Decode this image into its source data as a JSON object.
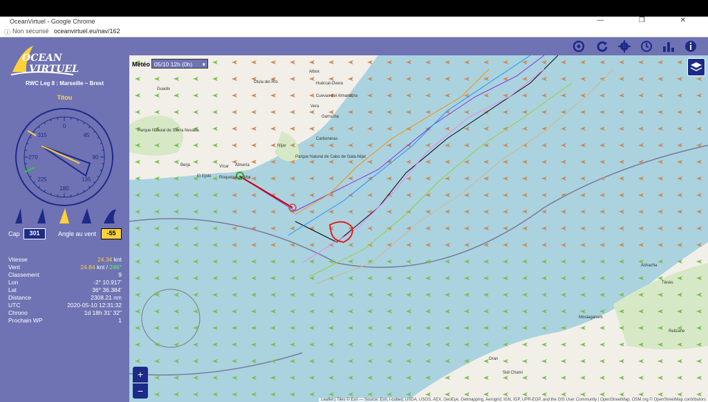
{
  "browser": {
    "window_title": "OceanVirtuel - Google Chrome",
    "security_label": "Non sécurisé",
    "url": "oceanvirtuel.eu/nav/162",
    "window_controls": "— ❐ ✕"
  },
  "logo": {
    "line1": "OCEAN",
    "line2": "VIRTUEL"
  },
  "race": {
    "title": "RWC Leg 8 : Marseille ~ Brest"
  },
  "boat": {
    "name": "Titou"
  },
  "compass": {
    "labels": [
      "0",
      "45",
      "90",
      "135",
      "180",
      "225",
      "270",
      "315"
    ]
  },
  "heading": {
    "cap_label": "Cap",
    "cap_value": "301",
    "wind_angle_label": "Angle au vent",
    "wind_angle_value": "-55"
  },
  "stats": [
    {
      "label": "Vitesse",
      "value": "24.34",
      "unit": " knt"
    },
    {
      "label": "Vent",
      "value": "24.84",
      "unit": " knt / ",
      "extra": "246°"
    },
    {
      "label": "Classement",
      "value": "9",
      "unit": ""
    },
    {
      "label": "Lon",
      "value": "-2° 10.917'",
      "unit": ""
    },
    {
      "label": "Lat",
      "value": "36° 36.384'",
      "unit": ""
    },
    {
      "label": "Distance",
      "value": "2308.21 nm",
      "unit": ""
    },
    {
      "label": "UTC",
      "value": "2020-05-10 12:31:32",
      "unit": ""
    },
    {
      "label": "Chrono",
      "value": "1d 18h 31' 32\"",
      "unit": ""
    },
    {
      "label": "Prochain WP",
      "value": "1",
      "unit": ""
    }
  ],
  "meteo": {
    "label": "Météo",
    "selected": "05/10 12h (0h)"
  },
  "zoom": {
    "in": "+",
    "out": "−"
  },
  "map_labels": [
    "Almería",
    "Roquetas de Mar",
    "Níjar",
    "Berja",
    "Vícar",
    "El Ejido",
    "Albox",
    "Huércal-Overa",
    "Cuevas del Almanzora",
    "Vera",
    "Garrucha",
    "Carboneras",
    "Olula del Río",
    "Parque Natural de Sierra Nevada",
    "Parque Natural de Cabo de Gata-Níjar",
    "Guadix",
    "Mostaganem",
    "Relizane",
    "Oran",
    "Sidi Chami",
    "Achacha",
    "Ténès"
  ],
  "attribution": "Leaflet | Tiles © Esri — Source: Esri, i-cubed, USDA, USGS, AEX, GeoEye, Getmapping, Aerogrid, IGN, IGP, UPR-EGP, and the GIS User Community | OpenStreetMap, OSM.org © OpenStreetMap contributors",
  "colors": {
    "sidebar": "#6f73b3",
    "sea": "#aad3df",
    "land": "#f2efe9",
    "accent_blue": "#1c2a88",
    "wind_value": "#ffd23a",
    "wind_dir": "#5bff5b"
  },
  "icons": [
    "center-icon",
    "refresh-icon",
    "settings-icon",
    "clock-icon",
    "ranking-icon",
    "info-icon",
    "layers-icon"
  ]
}
